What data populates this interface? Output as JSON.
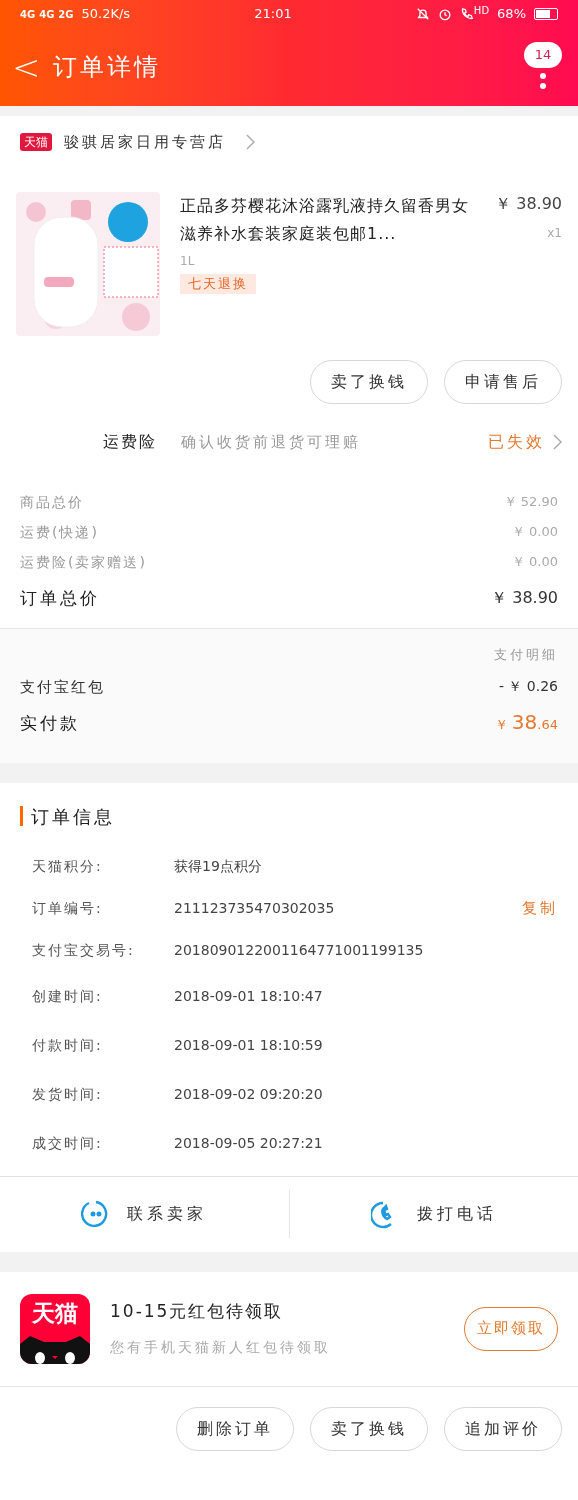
{
  "status_bar": {
    "networks": [
      "4G",
      "4G",
      "2G"
    ],
    "speed": "50.2K/s",
    "time": "21:01",
    "call_label": "HD",
    "battery": "68%"
  },
  "header": {
    "back": "<",
    "title": "订单详情",
    "badge": "14"
  },
  "store": {
    "logo": "天猫",
    "name": "骏骐居家日用专营店"
  },
  "product": {
    "title": "正品多芬樱花沐浴露乳液持久留香男女滋养补水套装家庭装包邮1...",
    "sku": "1L",
    "tag": "七天退换",
    "price": "￥ 38.90",
    "qty": "x1"
  },
  "product_buttons": [
    "卖了换钱",
    "申请售后"
  ],
  "insurance": {
    "label": "运费险",
    "desc": "确认收货前退货可理赔",
    "status": "已失效"
  },
  "price_rows": [
    {
      "label": "商品总价",
      "value": "￥ 52.90",
      "kind": "minor"
    },
    {
      "label": "运费(快递)",
      "value": "￥ 0.00",
      "kind": "minor"
    },
    {
      "label": "运费险(卖家赠送)",
      "value": "￥ 0.00",
      "kind": "minor"
    },
    {
      "label": "订单总价",
      "value": "￥ 38.90",
      "kind": "major"
    }
  ],
  "payment": {
    "detail_link": "支付明细",
    "rows": [
      {
        "label": "支付宝红包",
        "value": "- ￥ 0.26"
      }
    ],
    "paid_label": "实付款",
    "paid_currency": "￥",
    "paid_int": "38",
    "paid_dec": ".64"
  },
  "order_info": {
    "title": "订单信息",
    "rows": [
      {
        "label": "天猫积分:",
        "value": "获得19点积分"
      },
      {
        "label": "订单编号:",
        "value": "211123735470302035",
        "action": "复制"
      },
      {
        "label": "支付宝交易号:",
        "value": "2018090122001164771001199135"
      },
      {
        "label": "创建时间:",
        "value": "2018-09-01 18:10:47"
      },
      {
        "label": "付款时间:",
        "value": "2018-09-01 18:10:59"
      },
      {
        "label": "发货时间:",
        "value": "2018-09-02 09:20:20"
      },
      {
        "label": "成交时间:",
        "value": "2018-09-05 20:27:21"
      }
    ]
  },
  "contact": [
    {
      "kind": "chat",
      "label": "联系卖家"
    },
    {
      "kind": "phone",
      "label": "拨打电话"
    }
  ],
  "promo": {
    "logo": "天猫",
    "title": "10-15元红包待领取",
    "subtitle": "您有手机天猫新人红包待领取",
    "button": "立即领取"
  },
  "bottom_buttons": [
    "删除订单",
    "卖了换钱",
    "追加评价"
  ]
}
